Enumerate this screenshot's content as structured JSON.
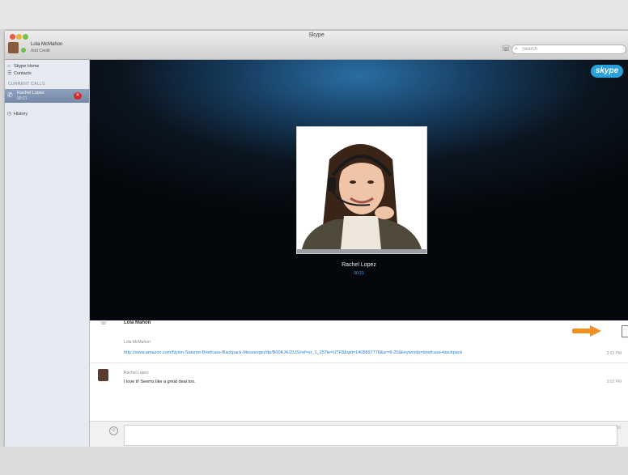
{
  "window": {
    "title": "Skype"
  },
  "account": {
    "name": "Lola McMahon",
    "credit": "Add Credit"
  },
  "search": {
    "placeholder": "Search"
  },
  "sidebar": {
    "items": [
      {
        "label": "Skype Home"
      },
      {
        "label": "Contacts"
      }
    ],
    "current_calls_heading": "CURRENT CALLS",
    "active_call": {
      "name": "Rachel Lopez",
      "time": "00:21"
    },
    "history": {
      "label": "History"
    }
  },
  "video": {
    "logo": "skype",
    "caller_name": "Rachel Lopez",
    "caller_status": "00:21"
  },
  "chat": {
    "topic": "Lola Mahon",
    "messages": [
      {
        "sender": "Lola McMahon",
        "text": "http://www.amazon.com/Nylon-Saturne-Briefcase-Backpack-Messenger/dp/B00KJ4JZUS/ref=sr_1_25?ie=UTF8&qid=1408897778&sr=8-25&keywords=briefcase+backpack",
        "time": "3:02 PM"
      },
      {
        "sender": "Rachel Lopez",
        "text": "I love it! Seems like a great deal too.",
        "time": "3:02 PM"
      }
    ]
  },
  "colors": {
    "accent_blue": "#2aa0d9",
    "end_call_red": "#d8262c",
    "highlight_arrow": "#f09020",
    "sidebar_selected": "#7f93b2"
  }
}
